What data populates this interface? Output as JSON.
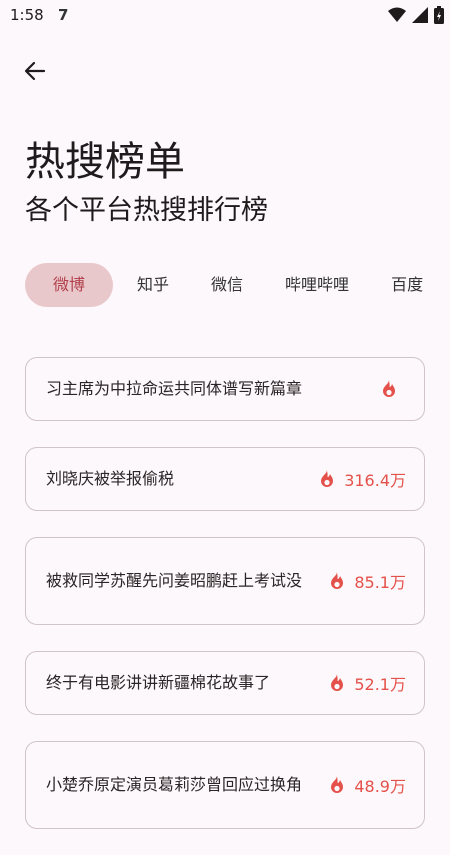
{
  "status": {
    "time": "1:58",
    "app_icon": "7"
  },
  "header": {
    "title": "热搜榜单",
    "subtitle": "各个平台热搜排行榜"
  },
  "tabs": [
    {
      "label": "微博",
      "active": true
    },
    {
      "label": "知乎",
      "active": false
    },
    {
      "label": "微信",
      "active": false
    },
    {
      "label": "哔哩哔哩",
      "active": false
    },
    {
      "label": "百度",
      "active": false
    }
  ],
  "items": [
    {
      "title": "习主席为中拉命运共同体谱写新篇章",
      "heat": ""
    },
    {
      "title": "刘晓庆被举报偷税",
      "heat": "316.4万"
    },
    {
      "title": "被救同学苏醒先问姜昭鹏赶上考试没",
      "heat": "85.1万"
    },
    {
      "title": "终于有电影讲讲新疆棉花故事了",
      "heat": "52.1万"
    },
    {
      "title": "小楚乔原定演员葛莉莎曾回应过换角",
      "heat": "48.9万"
    }
  ],
  "colors": {
    "accent": "#b2424d",
    "heat": "#e4514a",
    "tab_active_bg": "#e9c8cc",
    "background": "#fdf8fb"
  }
}
